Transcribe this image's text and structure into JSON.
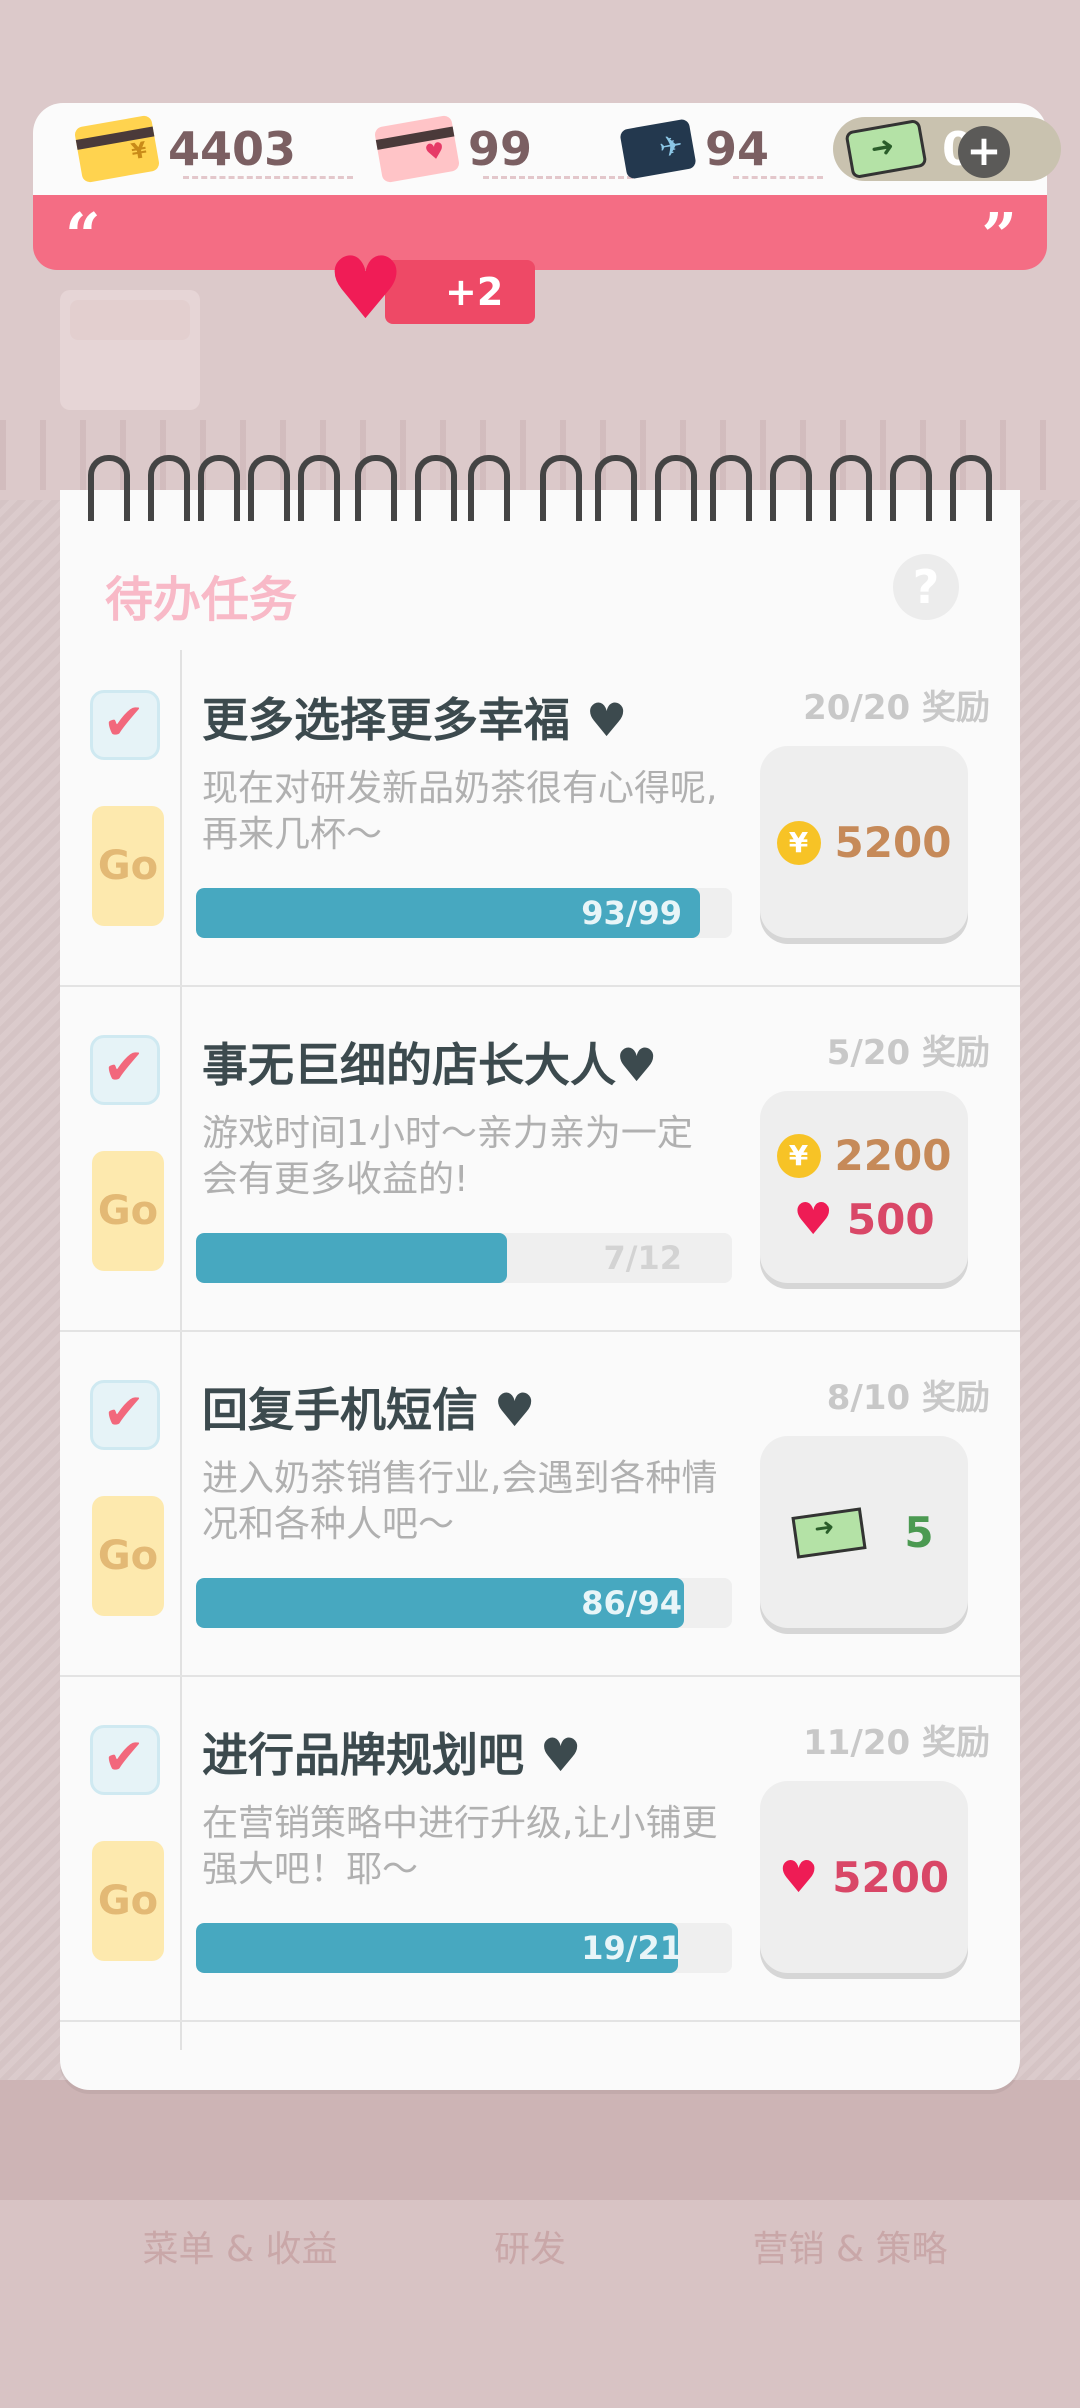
{
  "currency": {
    "coins": "4403",
    "hearts": "99",
    "tickets": "94",
    "cash": "0",
    "plus_label": "+"
  },
  "quote": {
    "open": "“",
    "close": "”"
  },
  "heart_gain": "+2",
  "panel": {
    "title": "待办任务",
    "help_label": "?"
  },
  "tasks": [
    {
      "title": "更多选择更多幸福 ♥",
      "desc": "现在对研发新品奶茶很有心得呢,再来几杯～",
      "progress_text": "93/99",
      "progress": 0.94,
      "reward_progress": "20/20 奖励",
      "rewards": [
        {
          "type": "coin",
          "icon": "¥",
          "value": "5200",
          "color": "#c68a59"
        }
      ],
      "go_label": "Go"
    },
    {
      "title": "事无巨细的店长大人♥",
      "desc": "游戏时间1小时～亲力亲为一定会有更多收益的!",
      "progress_text": "7/12",
      "progress": 0.58,
      "reward_progress": "5/20 奖励",
      "rewards": [
        {
          "type": "coin",
          "icon": "¥",
          "value": "2200",
          "color": "#c68a59"
        },
        {
          "type": "heart",
          "icon": "♥",
          "value": "500",
          "color": "#d94767"
        }
      ],
      "go_label": "Go"
    },
    {
      "title": "回复手机短信 ♥",
      "desc": "进入奶茶销售行业,会遇到各种情况和各种人吧～",
      "progress_text": "86/94",
      "progress": 0.91,
      "reward_progress": "8/10 奖励",
      "rewards": [
        {
          "type": "cash",
          "icon": "cash-icon",
          "value": "5",
          "color": "#4c9a52"
        }
      ],
      "go_label": "Go"
    },
    {
      "title": "进行品牌规划吧 ♥",
      "desc": "在营销策略中进行升级,让小铺更强大吧！耶～",
      "progress_text": "19/21",
      "progress": 0.9,
      "reward_progress": "11/20 奖励",
      "rewards": [
        {
          "type": "heart",
          "icon": "♥",
          "value": "5200",
          "color": "#d94767"
        }
      ],
      "go_label": "Go"
    }
  ],
  "bottom_tabs": [
    "菜单 & 收益",
    "研发",
    "营销 & 策略"
  ]
}
